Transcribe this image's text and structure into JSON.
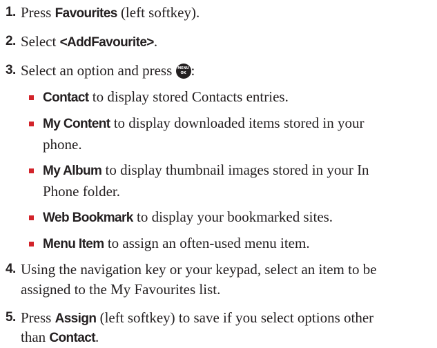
{
  "steps": [
    {
      "num": "1.",
      "pre": "Press ",
      "kw": "Favourites",
      "post": " (left softkey)."
    },
    {
      "num": "2.",
      "pre": "Select ",
      "kw": "<AddFavourite>",
      "post": "."
    },
    {
      "num": "3.",
      "pre": "Select an option and press ",
      "icon_name": "menu-ok-key-icon",
      "icon_text_top": "MENU",
      "icon_text_bottom": "OK",
      "post": ":"
    },
    {
      "num": "4.",
      "line1": "Using the navigation key or your keypad, select an item to be",
      "line2": "assigned to the My Favourites list."
    },
    {
      "num": "5.",
      "pre": "Press ",
      "kw": "Assign",
      "post": " (left softkey) to save if you select options other",
      "line2_pre": "than ",
      "line2_kw": "Contact",
      "line2_post": "."
    }
  ],
  "options": [
    {
      "label": "Contact",
      "text": " to display stored Contacts entries."
    },
    {
      "label": "My Content",
      "text": " to display downloaded items stored in your",
      "text2": "phone."
    },
    {
      "label": "My Album",
      "text": " to display thumbnail images stored in your In",
      "text2": "Phone folder."
    },
    {
      "label": "Web Bookmark",
      "text": " to display your bookmarked sites."
    },
    {
      "label": "Menu Item",
      "text": " to assign an often-used menu item."
    }
  ],
  "colors": {
    "bullet": "#d2232a",
    "text": "#231f20"
  }
}
